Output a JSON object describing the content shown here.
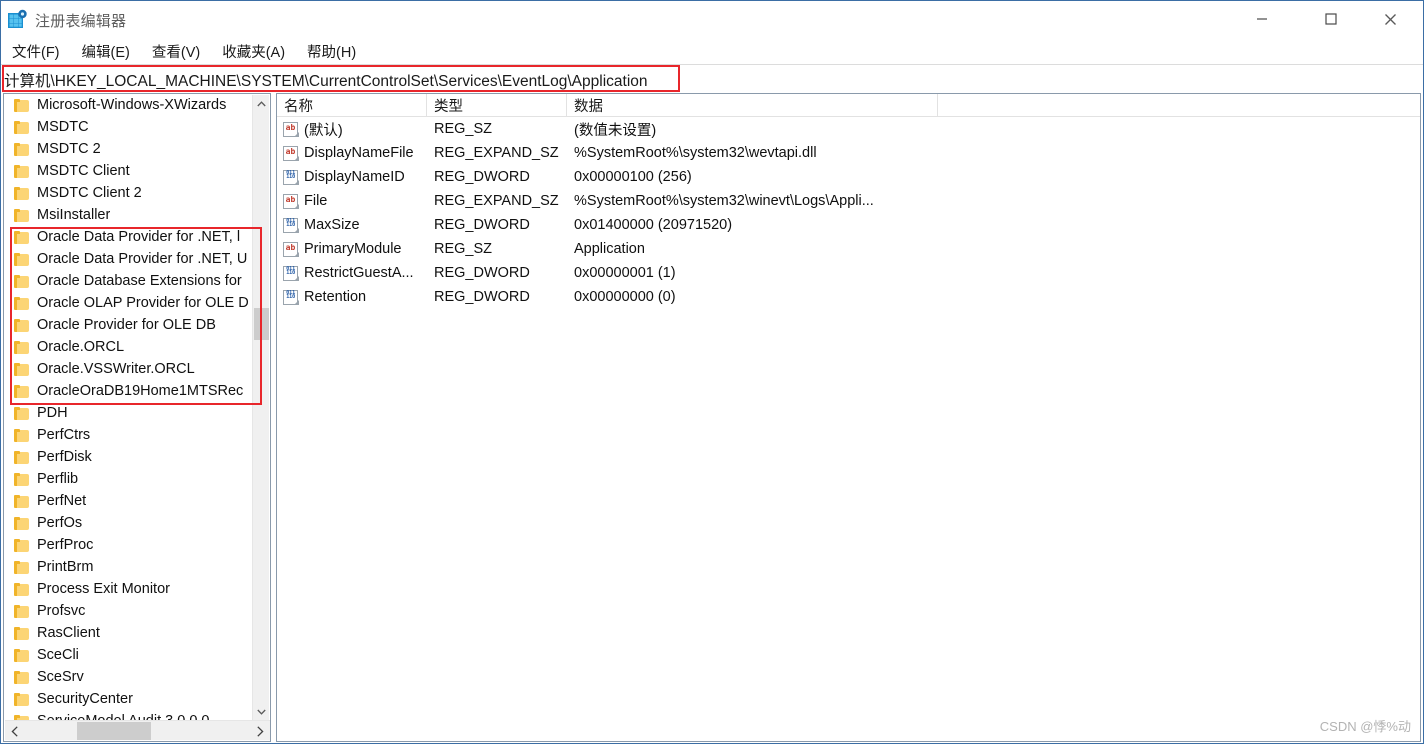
{
  "window": {
    "title": "注册表编辑器",
    "app_icon": "registry-editor-icon",
    "minimize_label": "最小化",
    "maximize_label": "最大化",
    "close_label": "关闭"
  },
  "menu": {
    "items": [
      {
        "label": "文件(F)"
      },
      {
        "label": "编辑(E)"
      },
      {
        "label": "查看(V)"
      },
      {
        "label": "收藏夹(A)"
      },
      {
        "label": "帮助(H)"
      }
    ]
  },
  "address": {
    "value": "计算机\\HKEY_LOCAL_MACHINE\\SYSTEM\\CurrentControlSet\\Services\\EventLog\\Application",
    "placeholder": "",
    "highlight_color": "#e8262b"
  },
  "tree": {
    "items": [
      {
        "label": "Microsoft-Windows-XWizards",
        "highlighted": false
      },
      {
        "label": "MSDTC",
        "highlighted": false
      },
      {
        "label": "MSDTC 2",
        "highlighted": false
      },
      {
        "label": "MSDTC Client",
        "highlighted": false
      },
      {
        "label": "MSDTC Client 2",
        "highlighted": false
      },
      {
        "label": "MsiInstaller",
        "highlighted": false
      },
      {
        "label": "Oracle Data Provider for .NET, l",
        "highlighted": true
      },
      {
        "label": "Oracle Data Provider for .NET, U",
        "highlighted": true
      },
      {
        "label": "Oracle Database Extensions for",
        "highlighted": true
      },
      {
        "label": "Oracle OLAP Provider for OLE D",
        "highlighted": true
      },
      {
        "label": "Oracle Provider for OLE DB",
        "highlighted": true
      },
      {
        "label": "Oracle.ORCL",
        "highlighted": true
      },
      {
        "label": "Oracle.VSSWriter.ORCL",
        "highlighted": true
      },
      {
        "label": "OracleOraDB19Home1MTSRec",
        "highlighted": true
      },
      {
        "label": "PDH",
        "highlighted": false
      },
      {
        "label": "PerfCtrs",
        "highlighted": false
      },
      {
        "label": "PerfDisk",
        "highlighted": false
      },
      {
        "label": "Perflib",
        "highlighted": false
      },
      {
        "label": "PerfNet",
        "highlighted": false
      },
      {
        "label": "PerfOs",
        "highlighted": false
      },
      {
        "label": "PerfProc",
        "highlighted": false
      },
      {
        "label": "PrintBrm",
        "highlighted": false
      },
      {
        "label": "Process Exit Monitor",
        "highlighted": false
      },
      {
        "label": "Profsvc",
        "highlighted": false
      },
      {
        "label": "RasClient",
        "highlighted": false
      },
      {
        "label": "SceCli",
        "highlighted": false
      },
      {
        "label": "SceSrv",
        "highlighted": false
      },
      {
        "label": "SecurityCenter",
        "highlighted": false
      },
      {
        "label": "ServiceModel Audit 3.0.0.0",
        "highlighted": false
      }
    ],
    "highlight_color": "#e8262b"
  },
  "values": {
    "columns": [
      {
        "label": "名称"
      },
      {
        "label": "类型"
      },
      {
        "label": "数据"
      }
    ],
    "rows": [
      {
        "icon": "string-value-icon",
        "name": "(默认)",
        "type": "REG_SZ",
        "data": "(数值未设置)"
      },
      {
        "icon": "string-value-icon",
        "name": "DisplayNameFile",
        "type": "REG_EXPAND_SZ",
        "data": "%SystemRoot%\\system32\\wevtapi.dll"
      },
      {
        "icon": "dword-value-icon",
        "name": "DisplayNameID",
        "type": "REG_DWORD",
        "data": "0x00000100 (256)"
      },
      {
        "icon": "string-value-icon",
        "name": "File",
        "type": "REG_EXPAND_SZ",
        "data": "%SystemRoot%\\system32\\winevt\\Logs\\Appli..."
      },
      {
        "icon": "dword-value-icon",
        "name": "MaxSize",
        "type": "REG_DWORD",
        "data": "0x01400000 (20971520)"
      },
      {
        "icon": "string-value-icon",
        "name": "PrimaryModule",
        "type": "REG_SZ",
        "data": "Application"
      },
      {
        "icon": "dword-value-icon",
        "name": "RestrictGuestA...",
        "type": "REG_DWORD",
        "data": "0x00000001 (1)"
      },
      {
        "icon": "dword-value-icon",
        "name": "Retention",
        "type": "REG_DWORD",
        "data": "0x00000000 (0)"
      }
    ]
  },
  "scrollbars": {
    "tree_vertical_up": "▲",
    "tree_vertical_down": "▼",
    "tree_horizontal_left": "‹",
    "tree_horizontal_right": "›"
  },
  "watermark": {
    "text": "CSDN @悸%动"
  }
}
